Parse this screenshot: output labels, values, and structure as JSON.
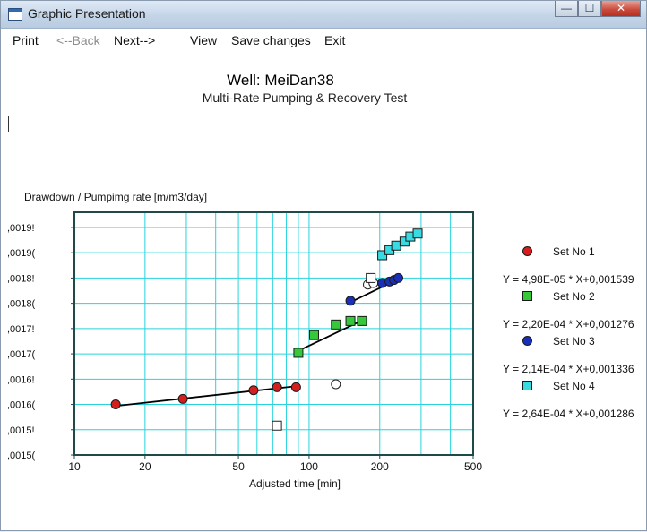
{
  "window": {
    "title": "Graphic Presentation",
    "controls": {
      "minimize": "—",
      "maximize": "☐",
      "close": "✕"
    }
  },
  "menu": {
    "print": "Print",
    "back": "<--Back",
    "next": "Next-->",
    "view": "View",
    "save": "Save changes",
    "exit": "Exit"
  },
  "header": {
    "title": "Well: MeiDan38",
    "subtitle": "Multi-Rate Pumping & Recovery Test"
  },
  "chart_data": {
    "type": "scatter",
    "ylabel": "Drawdown / Pumpimg rate [m/m3/day]",
    "xlabel": "Adjusted time [min]",
    "x_scale": "log",
    "xlim": [
      10,
      500
    ],
    "ylim": [
      0.0015,
      0.00198
    ],
    "x_tick_labels": [
      {
        "value": 10,
        "label": "10"
      },
      {
        "value": 20,
        "label": "20"
      },
      {
        "value": 50,
        "label": "50"
      },
      {
        "value": 100,
        "label": "100"
      },
      {
        "value": 200,
        "label": "200"
      },
      {
        "value": 500,
        "label": "500"
      }
    ],
    "y_tick_labels": [
      {
        "value": 0.00195,
        "label": ",0019!"
      },
      {
        "value": 0.0019,
        "label": ",0019("
      },
      {
        "value": 0.00185,
        "label": ",0018!"
      },
      {
        "value": 0.0018,
        "label": ",0018("
      },
      {
        "value": 0.00175,
        "label": ",0017!"
      },
      {
        "value": 0.0017,
        "label": ",0017("
      },
      {
        "value": 0.00165,
        "label": ",0016!"
      },
      {
        "value": 0.0016,
        "label": ",0016("
      },
      {
        "value": 0.00155,
        "label": ",0015!"
      },
      {
        "value": 0.0015,
        "label": ",0015("
      }
    ],
    "grid": true,
    "legend_position": "right",
    "colors": {
      "axis": "#1e4a4a",
      "grid": "#27d4dc",
      "fit_line": "#000000"
    },
    "series": [
      {
        "name": "Set No 1",
        "marker": "circle",
        "color": "#d51f1f",
        "equation": "Y = 4,98E-05 * X+0,001539",
        "points": [
          [
            15,
            0.0016
          ],
          [
            29,
            0.001611
          ],
          [
            58,
            0.001628
          ],
          [
            73,
            0.001634
          ],
          [
            88,
            0.001634
          ]
        ],
        "fit": [
          [
            15,
            0.001597
          ],
          [
            88,
            0.001636
          ]
        ]
      },
      {
        "name": "Set No 2",
        "marker": "square",
        "color": "#34c83a",
        "equation": "Y = 2,20E-04 * X+0,001276",
        "points": [
          [
            90,
            0.001702
          ],
          [
            105,
            0.001737
          ],
          [
            130,
            0.001758
          ],
          [
            150,
            0.001765
          ],
          [
            168,
            0.001765
          ]
        ],
        "fit": [
          [
            90,
            0.001706
          ],
          [
            168,
            0.001766
          ]
        ]
      },
      {
        "name": "Set No 3",
        "marker": "circle",
        "color": "#1a2fb8",
        "equation": "Y = 2,14E-04 * X+0,001336",
        "points": [
          [
            150,
            0.001805
          ],
          [
            205,
            0.00184
          ],
          [
            220,
            0.001843
          ],
          [
            230,
            0.001846
          ],
          [
            240,
            0.00185
          ]
        ],
        "fit": [
          [
            150,
            0.001802
          ],
          [
            240,
            0.001848
          ]
        ]
      },
      {
        "name": "Set No 4",
        "marker": "square",
        "color": "#39dbe3",
        "equation": "Y = 2,64E-04 * X+0,001286",
        "points": [
          [
            205,
            0.001895
          ],
          [
            220,
            0.001905
          ],
          [
            235,
            0.001914
          ],
          [
            255,
            0.001922
          ],
          [
            270,
            0.001932
          ],
          [
            290,
            0.001938
          ]
        ],
        "fit": []
      }
    ],
    "excluded_points": [
      {
        "marker": "circle",
        "x": 130,
        "y": 0.00164
      },
      {
        "marker": "square",
        "x": 73,
        "y": 0.001558
      },
      {
        "marker": "circle",
        "x": 178,
        "y": 0.001837
      },
      {
        "marker": "circle",
        "x": 188,
        "y": 0.00184
      },
      {
        "marker": "square",
        "x": 183,
        "y": 0.00185
      }
    ]
  }
}
